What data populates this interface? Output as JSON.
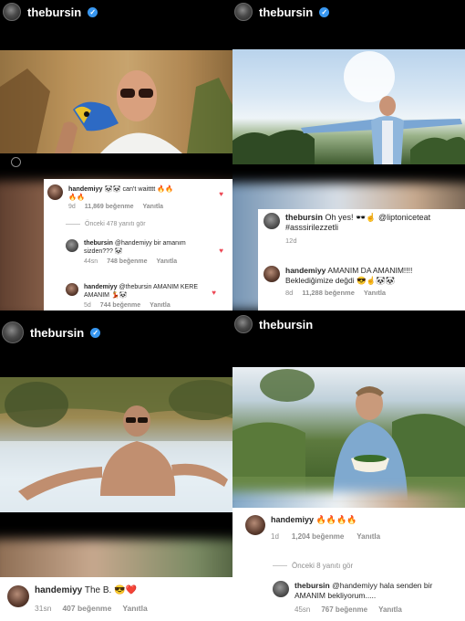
{
  "panels": {
    "tl": {
      "username": "thebursin",
      "comments": {
        "main": {
          "user": "handemiyy",
          "text": "🔥🔥",
          "prefix": "🐼🐼 can't waitttt 🔥🔥",
          "time": "9d",
          "likes": "11,869 beğenme",
          "reply": "Yanıtla"
        },
        "previous": "Önceki 478 yanıtı gör",
        "reply1": {
          "user": "thebursin",
          "text": "@handemiyy bir amanım sizden??? 🐼",
          "time": "44sn",
          "likes": "748 beğenme",
          "reply": "Yanıtla"
        },
        "reply2": {
          "user": "handemiyy",
          "text": "@thebursin AMANIM KERE AMANIM 💃🐼",
          "time": "5d",
          "likes": "744 beğenme",
          "reply": "Yanıtla"
        }
      }
    },
    "tr": {
      "username": "thebursin",
      "comments": {
        "main": {
          "user": "thebursin",
          "text": "Oh yes! 🕶️☝️ @liptoniceteat #asssirilezzetli",
          "time": "12d"
        },
        "reply": {
          "user": "handemiyy",
          "text": "AMANIM DA AMANIM!!!! Beklediğimize değdi 😎☝️🐼🐼",
          "time": "8d",
          "likes": "11,288 beğenme",
          "reply": "Yanıtla"
        }
      }
    },
    "bl": {
      "username": "thebursin",
      "comment": {
        "user": "handemiyy",
        "text": "The B. 😎❤️",
        "time": "31sn",
        "likes": "407 beğenme",
        "reply": "Yanıtla"
      }
    },
    "br": {
      "username": "thebursin",
      "comments": {
        "main": {
          "user": "handemiyy",
          "text": "🔥🔥🔥🔥",
          "time": "1d",
          "likes": "1,204 beğenme",
          "reply": "Yanıtla"
        },
        "previous": "Önceki 8 yanıtı gör",
        "reply": {
          "user": "thebursin",
          "text": "@handemiyy hala senden bir AMANIM bekliyorum.....",
          "time": "45sn",
          "likes": "767 beğenme",
          "reply": "Yanıtla"
        }
      }
    }
  },
  "colors": {
    "accent": "#3897f0",
    "heart": "#ed4956",
    "muted": "#8e8e8e",
    "text": "#262626"
  }
}
